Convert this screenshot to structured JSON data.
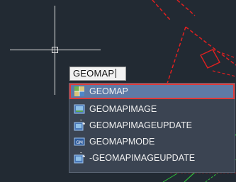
{
  "command_line": {
    "input_value": "GEOMAP"
  },
  "autocomplete": {
    "items": [
      {
        "label": "GEOMAP",
        "icon": "geomap-grid-icon",
        "selected": true
      },
      {
        "label": "GEOMAPIMAGE",
        "icon": "geomap-image-icon",
        "selected": false
      },
      {
        "label": "GEOMAPIMAGEUPDATE",
        "icon": "geomap-image-update-icon",
        "selected": false
      },
      {
        "label": "GEOMAPMODE",
        "icon": "geomap-mode-icon",
        "selected": false
      },
      {
        "label": "-GEOMAPIMAGEUPDATE",
        "icon": "geomap-image-update-icon",
        "selected": false
      }
    ]
  },
  "colors": {
    "canvas_background": "#222a33",
    "selection_highlight": "#5e7aa6",
    "selection_border": "#e03a3a",
    "drawing_red": "#e02020",
    "drawing_green": "#2fbf3a"
  }
}
